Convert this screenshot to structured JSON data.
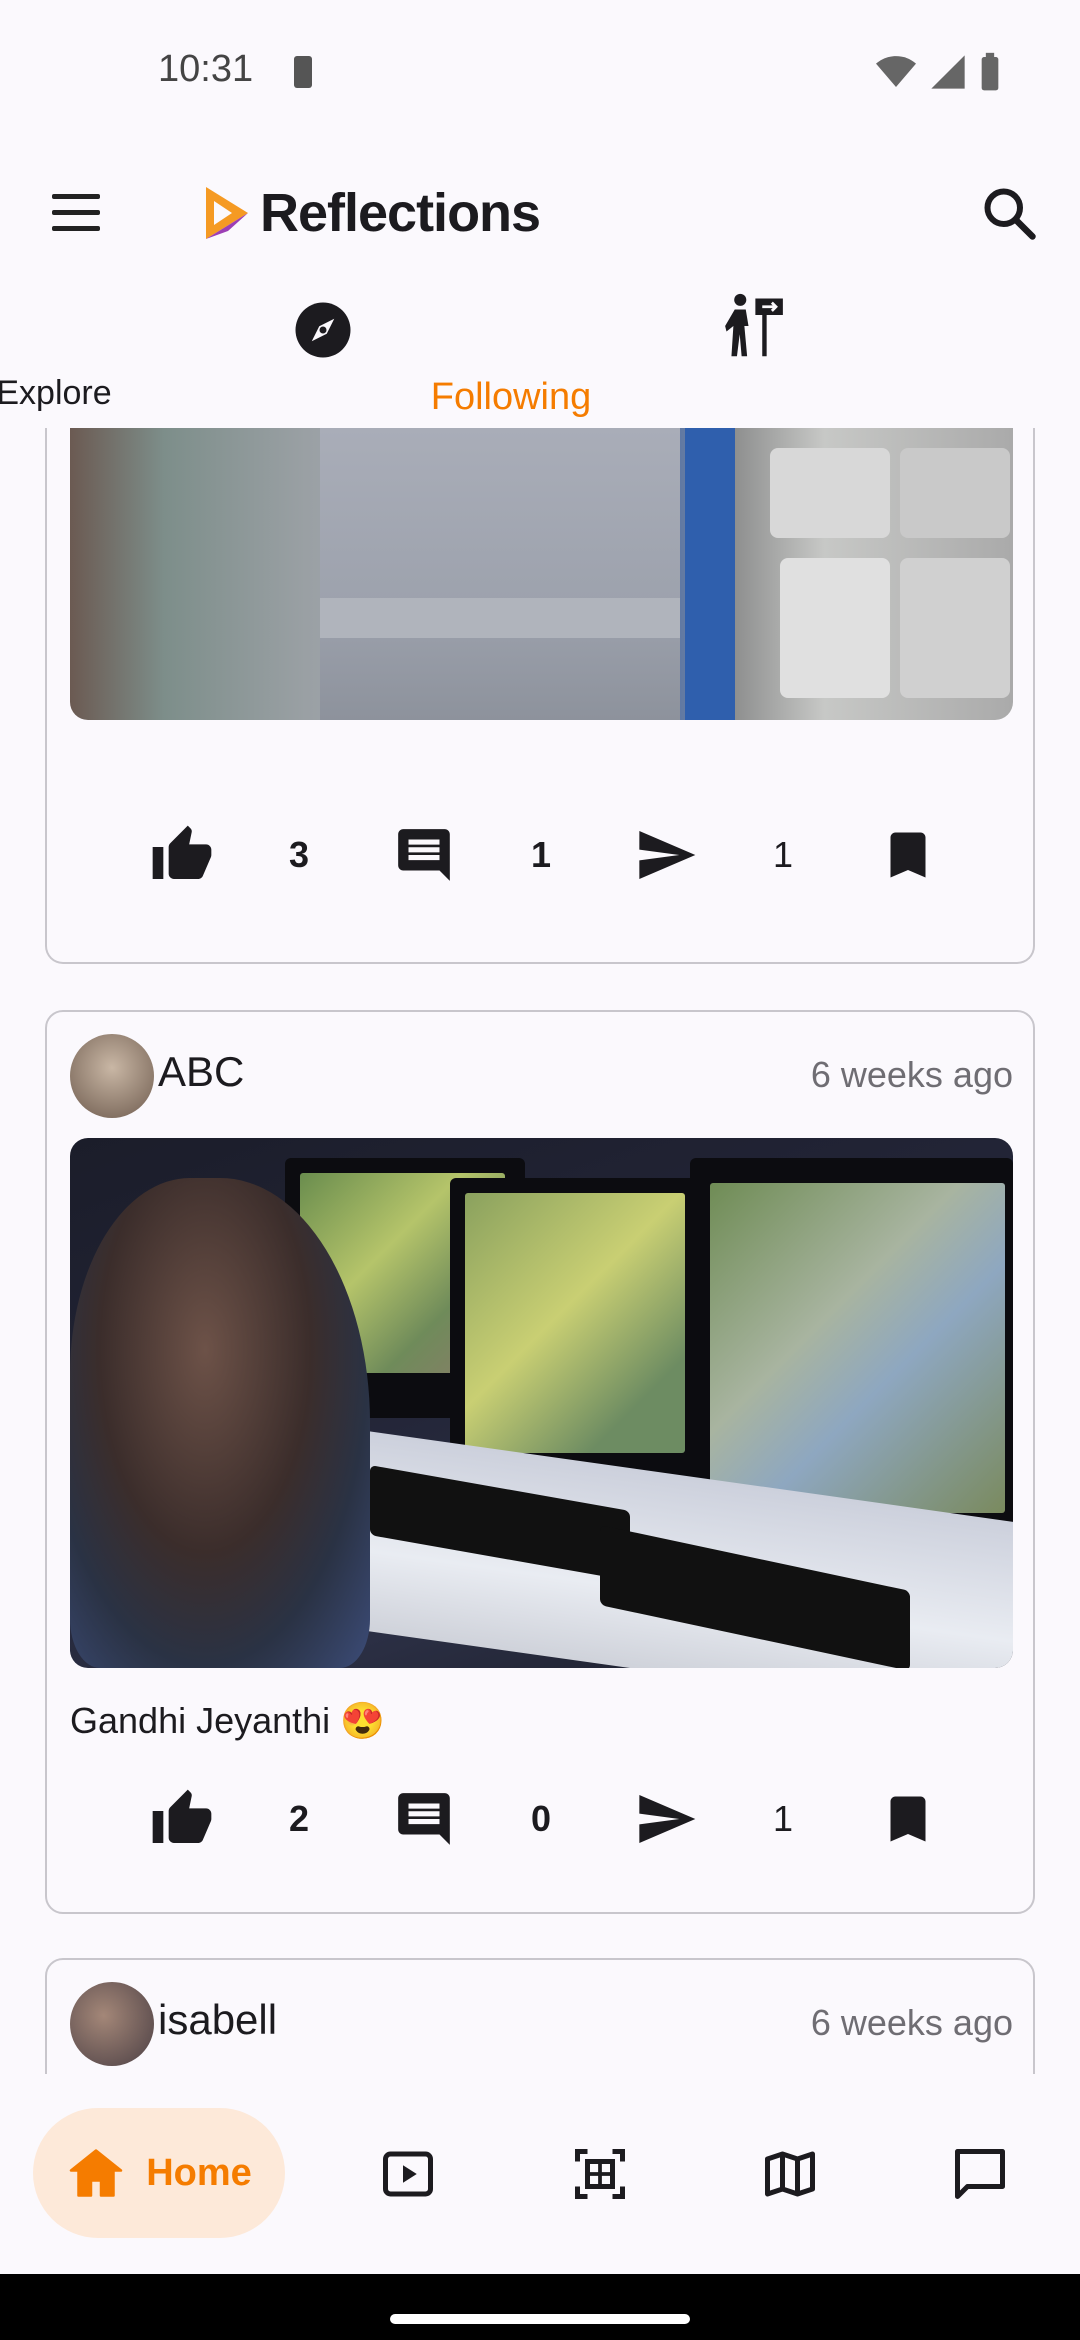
{
  "status_bar": {
    "time": "10:31"
  },
  "app_bar": {
    "title": "Reflections"
  },
  "tabs": [
    {
      "label": "Explore",
      "selected": false
    },
    {
      "label": "Following",
      "selected": true
    }
  ],
  "posts": [
    {
      "likes": "3",
      "comments": "1",
      "shares": "1"
    },
    {
      "username": "ABC",
      "time_ago": "6 weeks ago",
      "caption": "Gandhi Jeyanthi 😍",
      "likes": "2",
      "comments": "0",
      "shares": "1"
    },
    {
      "username": "isabell",
      "time_ago": "6 weeks ago"
    }
  ],
  "bottom_nav": {
    "home_label": "Home"
  },
  "colors": {
    "accent": "#f57c00",
    "accent_container": "#fde9d9",
    "background": "#fbf9fd"
  }
}
